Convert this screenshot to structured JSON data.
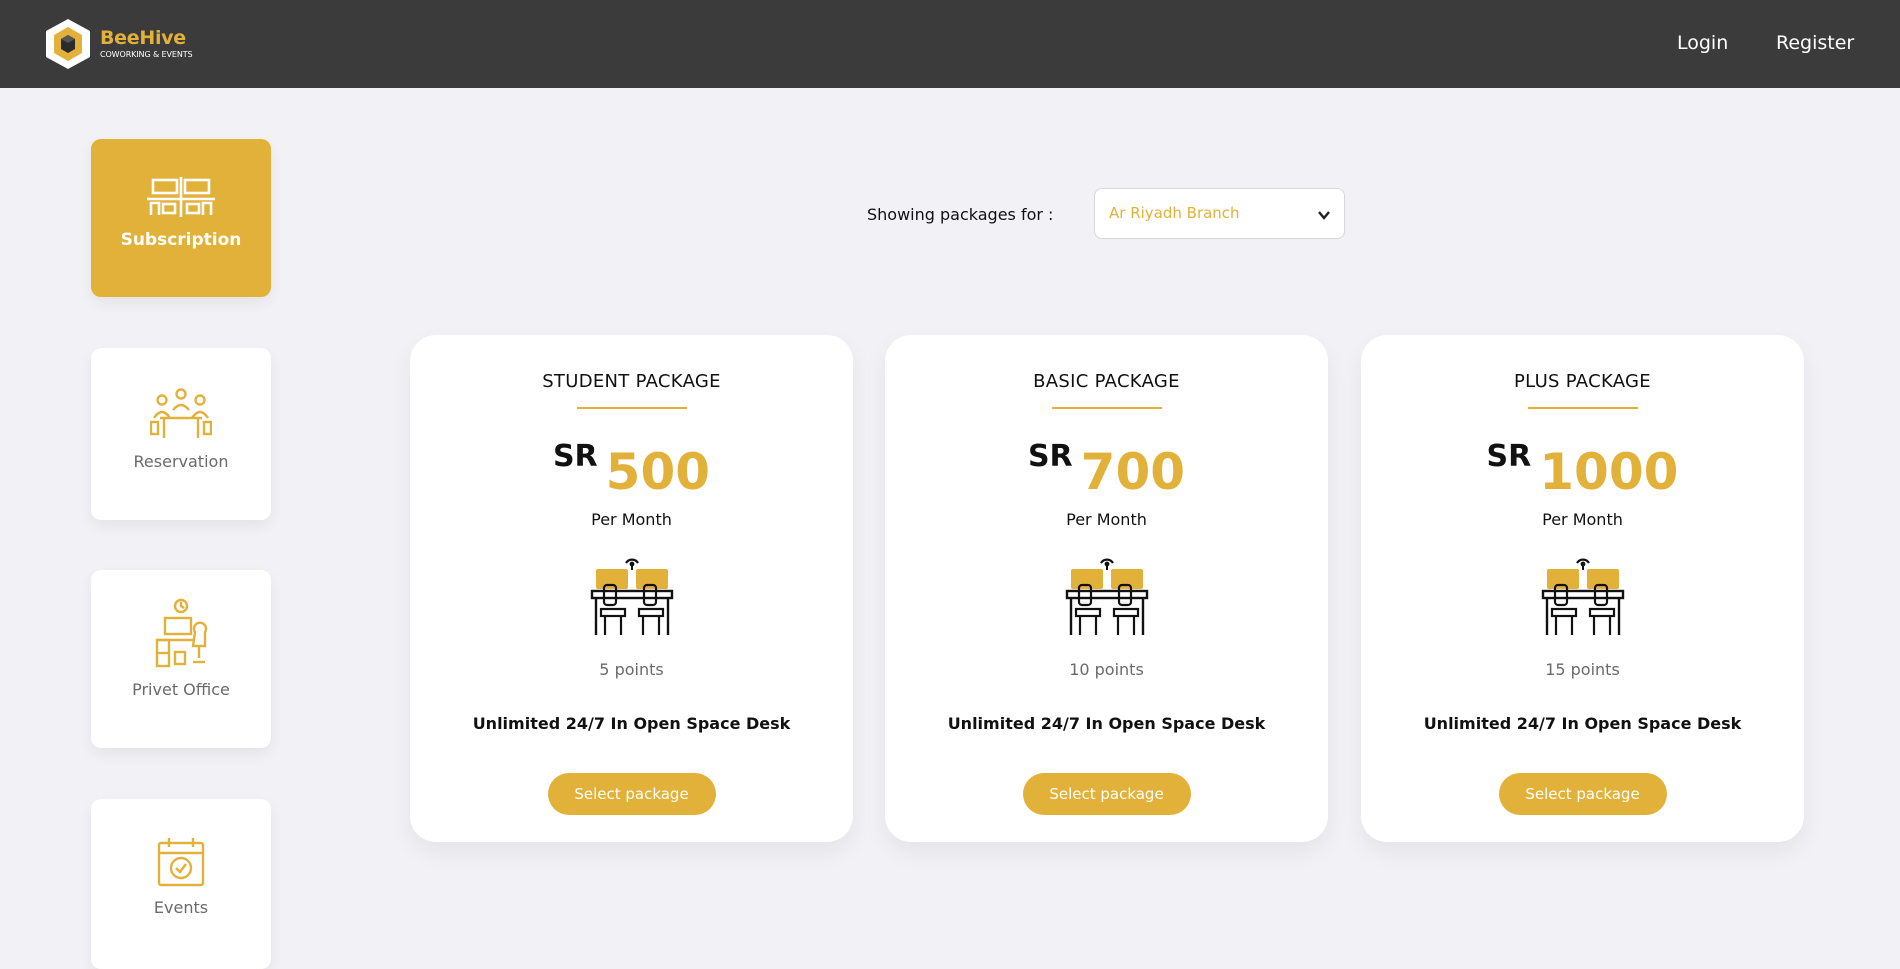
{
  "brand": {
    "name": "BeeHive",
    "tagline": "COWORKING & EVENTS"
  },
  "nav": {
    "login": "Login",
    "register": "Register"
  },
  "colors": {
    "accent": "#e2b13a",
    "topbar": "#3b3b3b",
    "background": "#f1f1f6"
  },
  "sidebar": {
    "items": [
      {
        "label": "Subscription",
        "icon": "workstation-icon",
        "active": true
      },
      {
        "label": "Reservation",
        "icon": "meeting-table-icon",
        "active": false
      },
      {
        "label": "Privet Office",
        "icon": "office-desk-icon",
        "active": false
      },
      {
        "label": "Events",
        "icon": "calendar-check-icon",
        "active": false
      }
    ]
  },
  "filter": {
    "label": "Showing packages for :",
    "selected": "Ar Riyadh Branch"
  },
  "packages": [
    {
      "title": "STUDENT PACKAGE",
      "currency": "SR",
      "price": "500",
      "period": "Per Month",
      "points": "5 points",
      "description": "Unlimited 24/7 In Open Space Desk",
      "button": "Select package"
    },
    {
      "title": "BASIC PACKAGE",
      "currency": "SR",
      "price": "700",
      "period": "Per Month",
      "points": "10 points",
      "description": "Unlimited 24/7 In Open Space Desk",
      "button": "Select package"
    },
    {
      "title": "PLUS PACKAGE",
      "currency": "SR",
      "price": "1000",
      "period": "Per Month",
      "points": "15 points",
      "description": "Unlimited 24/7 In Open Space Desk",
      "button": "Select package"
    }
  ]
}
